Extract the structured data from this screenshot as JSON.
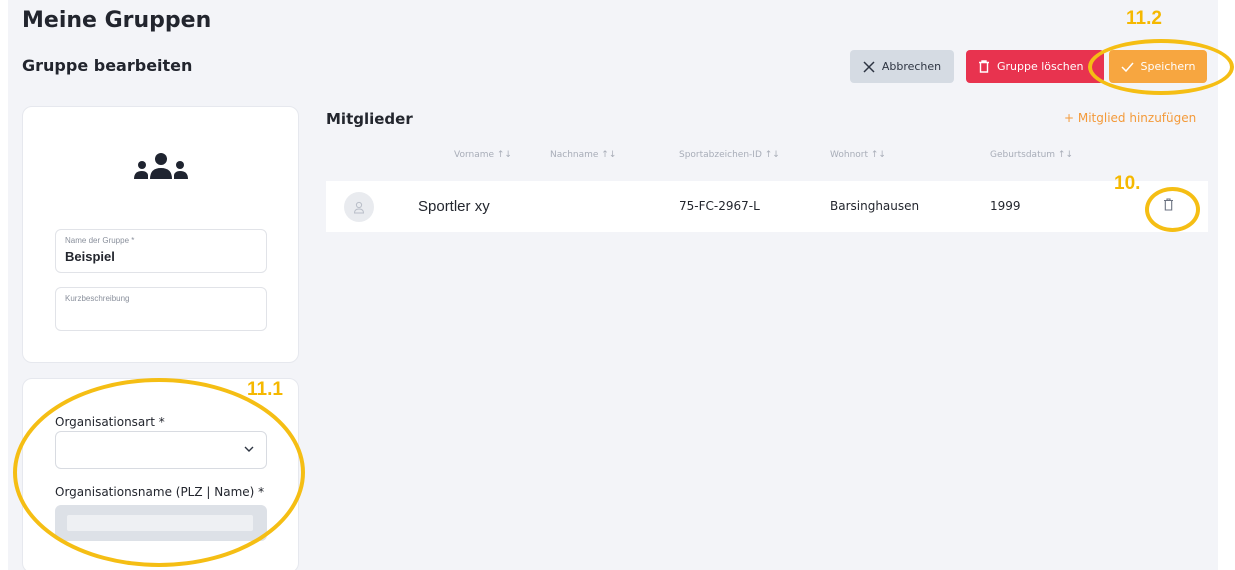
{
  "header": {
    "title": "Meine Gruppen",
    "subtitle": "Gruppe bearbeiten"
  },
  "actions": {
    "cancel_label": "Abbrechen",
    "delete_group_label": "Gruppe löschen",
    "save_label": "Speichern"
  },
  "group_form": {
    "icon": "group-icon",
    "name_label": "Name der Gruppe *",
    "name_value": "Beispiel",
    "description_label": "Kurzbeschreibung",
    "description_value": ""
  },
  "organisation": {
    "type_label": "Organisationsart *",
    "type_value": "",
    "name_label": "Organisationsname (PLZ | Name) *",
    "name_value": ""
  },
  "members": {
    "title": "Mitglieder",
    "add_label": "+ Mitglied hinzufügen",
    "columns": [
      "Vorname ↑↓",
      "Nachname ↑↓",
      "Sportabzeichen-ID ↑↓",
      "Wohnort ↑↓",
      "Geburtsdatum ↑↓"
    ],
    "rows": [
      {
        "name": "Sportler xy",
        "lastname": "",
        "sportabzeichen_id": "75-FC-2967-L",
        "wohnort": "Barsinghausen",
        "geburtsdatum": "1999"
      }
    ]
  },
  "annotations": {
    "save": "11.2",
    "row_delete": "10.",
    "organisation": "11.1"
  },
  "colors": {
    "accent_orange": "#f7a640",
    "danger_red": "#e8334f",
    "annotation_yellow": "#f5be14"
  }
}
